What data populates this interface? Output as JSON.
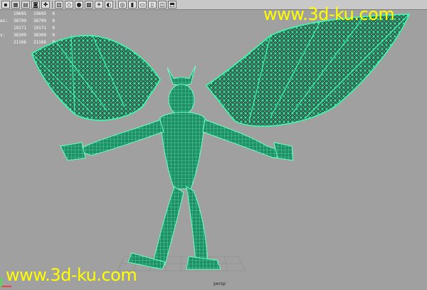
{
  "toolbar": {
    "buttons": [
      {
        "icon": "select-tool-icon",
        "glyph": "▪"
      },
      {
        "icon": "grid-icon",
        "glyph": "▦"
      },
      {
        "icon": "layer-icon",
        "glyph": "▤"
      },
      {
        "icon": "camera-icon",
        "glyph": "◙"
      },
      {
        "icon": "snap-icon",
        "glyph": "✚"
      },
      {
        "icon": "image-icon",
        "glyph": "▧"
      },
      {
        "icon": "wireframe-icon",
        "glyph": "◇"
      },
      {
        "icon": "smooth-shade-icon",
        "glyph": "●"
      },
      {
        "icon": "texture-icon",
        "glyph": "▩"
      },
      {
        "icon": "light-icon",
        "glyph": "☀"
      },
      {
        "icon": "isolate-icon",
        "glyph": "◐"
      },
      {
        "icon": "xray-icon",
        "glyph": "◎"
      },
      {
        "icon": "shadow-icon",
        "glyph": "▮"
      },
      {
        "icon": "resolution-gate-icon",
        "glyph": "▭"
      },
      {
        "icon": "film-gate-icon",
        "glyph": "▯"
      },
      {
        "icon": "safe-action-icon",
        "glyph": "◫"
      },
      {
        "icon": "bookmark-icon",
        "glyph": "⬒"
      }
    ]
  },
  "hud": {
    "rows": [
      {
        "label": "",
        "a": "19695",
        "b": "19695",
        "c": "0"
      },
      {
        "label": "es:",
        "a": "38799",
        "b": "38799",
        "c": "0"
      },
      {
        "label": "",
        "a": "19171",
        "b": "19171",
        "c": "0"
      },
      {
        "label": "s:",
        "a": "38309",
        "b": "38309",
        "c": "0"
      },
      {
        "label": "",
        "a": "21166",
        "b": "21166",
        "c": "0"
      }
    ]
  },
  "watermark_top": "www.3d-ku.com",
  "watermark_bottom": "www.3d-ku.com",
  "viewport_label": "persp",
  "colors": {
    "background": "#a0a0a0",
    "wire": "#3bffb0",
    "shade": "#2a2a2a",
    "watermark": "#ffff00",
    "axis_x": "#ff2020",
    "axis_y": "#20ff20"
  }
}
